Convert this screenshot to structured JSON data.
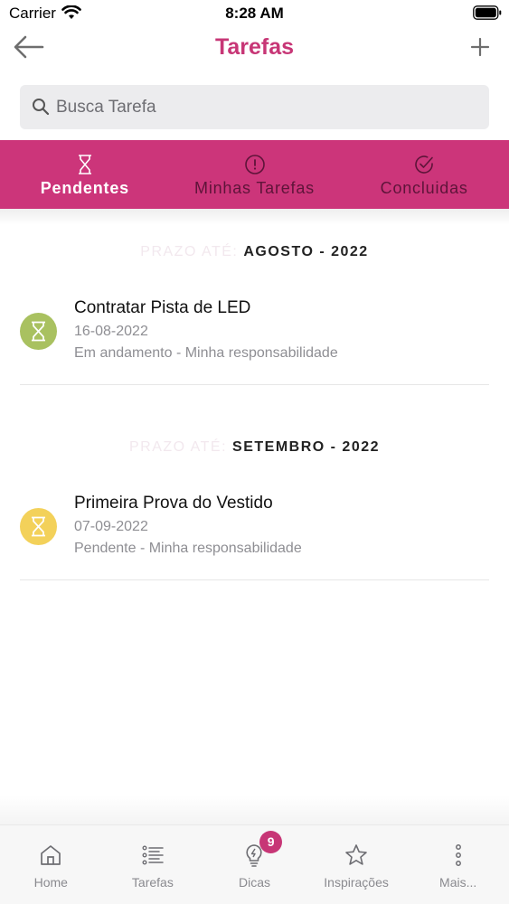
{
  "status_bar": {
    "carrier": "Carrier",
    "time": "8:28 AM"
  },
  "nav": {
    "title": "Tarefas",
    "back_icon": "arrow-left-icon",
    "add_icon": "plus-icon"
  },
  "search": {
    "placeholder": "Busca Tarefa",
    "value": ""
  },
  "tabs": [
    {
      "label": "Pendentes",
      "icon": "hourglass-icon",
      "active": true
    },
    {
      "label": "Minhas Tarefas",
      "icon": "alert-circle-icon",
      "active": false
    },
    {
      "label": "Concluidas",
      "icon": "check-circle-icon",
      "active": false
    }
  ],
  "sections": [
    {
      "prefix": "PRAZO ATÉ:",
      "month": "AGOSTO - 2022",
      "tasks": [
        {
          "title": "Contratar Pista de LED",
          "date": "16-08-2022",
          "status": "Em andamento - Minha responsabilidade",
          "status_color": "#a9c160"
        }
      ]
    },
    {
      "prefix": "PRAZO ATÉ:",
      "month": "SETEMBRO - 2022",
      "tasks": [
        {
          "title": "Primeira Prova do Vestido",
          "date": "07-09-2022",
          "status": "Pendente - Minha responsabilidade",
          "status_color": "#f3d15a"
        }
      ]
    }
  ],
  "bottom_tabs": [
    {
      "label": "Home",
      "icon": "home-icon"
    },
    {
      "label": "Tarefas",
      "icon": "list-icon"
    },
    {
      "label": "Dicas",
      "icon": "lightbulb-icon",
      "badge": "9"
    },
    {
      "label": "Inspirações",
      "icon": "star-icon"
    },
    {
      "label": "Mais...",
      "icon": "more-vertical-icon"
    }
  ],
  "colors": {
    "brand": "#cc357a",
    "title": "#c73676"
  }
}
